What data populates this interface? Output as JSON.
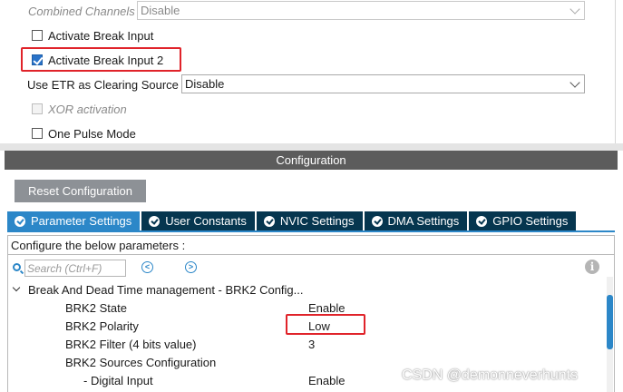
{
  "mode": {
    "combined_channels": {
      "label": "Combined Channels",
      "value": "Disable"
    },
    "activate_break_input": {
      "label": "Activate Break Input",
      "checked": false
    },
    "activate_break_input_2": {
      "label": "Activate Break Input 2",
      "checked": true
    },
    "use_etr": {
      "label": "Use ETR as Clearing Source",
      "value": "Disable"
    },
    "xor_activation": {
      "label": "XOR activation",
      "checked": false
    },
    "one_pulse_mode": {
      "label": "One Pulse Mode",
      "checked": false
    }
  },
  "configuration": {
    "header": "Configuration",
    "reset_button": "Reset Configuration",
    "tabs": [
      {
        "label": "Parameter Settings",
        "active": true
      },
      {
        "label": "User Constants",
        "active": false
      },
      {
        "label": "NVIC Settings",
        "active": false
      },
      {
        "label": "DMA Settings",
        "active": false
      },
      {
        "label": "GPIO Settings",
        "active": false
      }
    ],
    "params_title": "Configure the below parameters :",
    "search_placeholder": "Search (Ctrl+F)",
    "prev_glyph": "<",
    "next_glyph": ">",
    "info_glyph": "i",
    "group": "Break And Dead Time management - BRK2 Config...",
    "params": [
      {
        "key": "BRK2 State",
        "value": "Enable"
      },
      {
        "key": "BRK2 Polarity",
        "value": "Low"
      },
      {
        "key": "BRK2 Filter (4 bits value)",
        "value": "3"
      },
      {
        "key": "BRK2 Sources Configuration",
        "value": ""
      },
      {
        "key": "- Digital Input",
        "value": "Enable"
      }
    ]
  },
  "watermark": "CSDN @demonneverhunts",
  "colors": {
    "highlight": "#e0232a",
    "tab_active": "#2c87c8",
    "tab_inactive": "#06364f",
    "header": "#5c5c5c"
  }
}
